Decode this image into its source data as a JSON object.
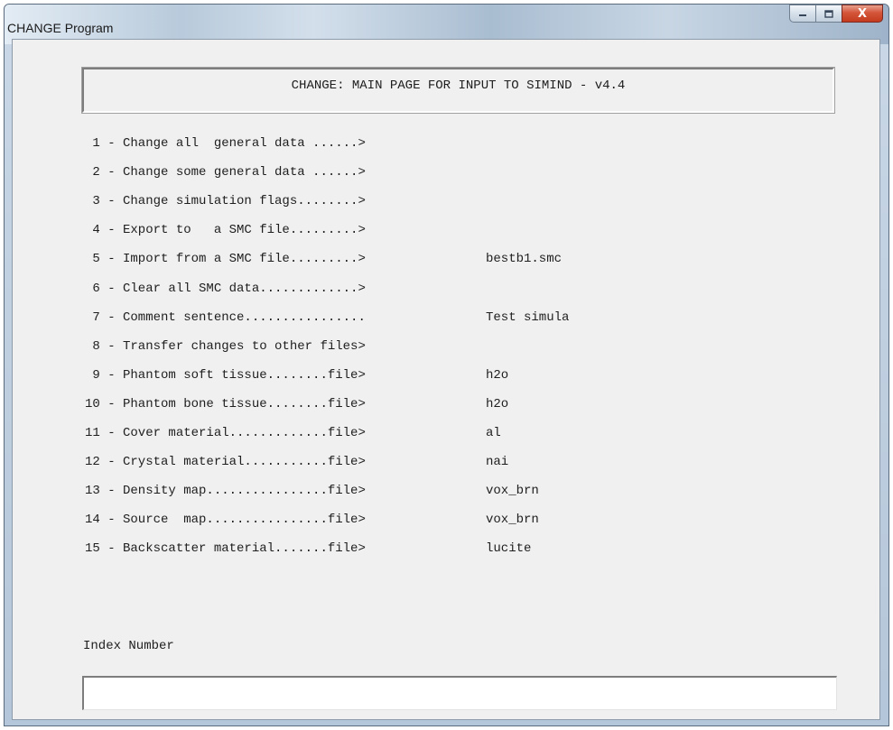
{
  "window": {
    "title": "CHANGE Program",
    "controls": {
      "minimize_icon": "minimize-icon",
      "maximize_icon": "maximize-icon",
      "close_icon": "close-icon",
      "close_glyph": "X"
    }
  },
  "header": {
    "title": "CHANGE: MAIN PAGE FOR INPUT TO SIMIND - v4.4"
  },
  "menu": {
    "items": [
      {
        "label": " 1 - Change all  general data ......>",
        "value": ""
      },
      {
        "label": " 2 - Change some general data ......>",
        "value": ""
      },
      {
        "label": " 3 - Change simulation flags........>",
        "value": ""
      },
      {
        "label": " 4 - Export to   a SMC file.........>",
        "value": ""
      },
      {
        "label": " 5 - Import from a SMC file.........>",
        "value": "bestb1.smc"
      },
      {
        "label": " 6 - Clear all SMC data.............>",
        "value": ""
      },
      {
        "label": " 7 - Comment sentence................",
        "value": "Test simula"
      },
      {
        "label": " 8 - Transfer changes to other files>",
        "value": ""
      },
      {
        "label": " 9 - Phantom soft tissue........file>",
        "value": "h2o"
      },
      {
        "label": "10 - Phantom bone tissue........file>",
        "value": "h2o"
      },
      {
        "label": "11 - Cover material.............file>",
        "value": "al"
      },
      {
        "label": "12 - Crystal material...........file>",
        "value": "nai"
      },
      {
        "label": "13 - Density map................file>",
        "value": "vox_brn"
      },
      {
        "label": "14 - Source  map................file>",
        "value": "vox_brn"
      },
      {
        "label": "15 - Backscatter material.......file>",
        "value": "lucite"
      }
    ]
  },
  "index": {
    "label": "Index Number",
    "value": ""
  }
}
